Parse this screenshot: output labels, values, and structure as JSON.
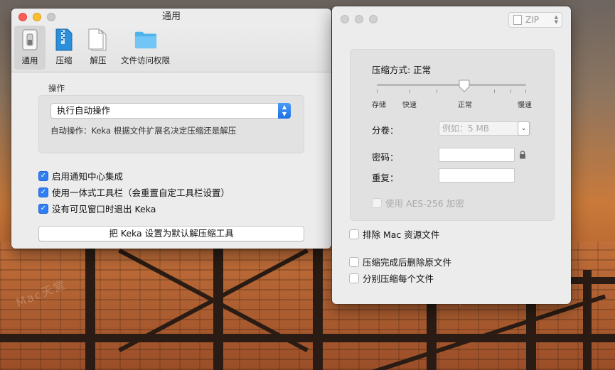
{
  "left_window": {
    "title": "通用",
    "toolbar": [
      {
        "label": "通用",
        "icon": "general-switch-icon",
        "active": true
      },
      {
        "label": "压缩",
        "icon": "zip-file-icon",
        "active": false
      },
      {
        "label": "解压",
        "icon": "extract-document-icon",
        "active": false
      },
      {
        "label": "文件访问权限",
        "icon": "folder-icon",
        "active": false
      }
    ],
    "operation": {
      "section_label": "操作",
      "selected": "执行自动操作",
      "help": "自动操作：Keka 根据文件扩展名决定压缩还是解压"
    },
    "checks": [
      {
        "label": "启用通知中心集成",
        "checked": true
      },
      {
        "label": "使用一体式工具栏（会重置自定工具栏设置）",
        "checked": true
      },
      {
        "label": "没有可见窗口时退出 Keka",
        "checked": true
      }
    ],
    "default_button": "把 Keka 设置为默认解压缩工具"
  },
  "right_window": {
    "format": "ZIP",
    "level_title": "压缩方式: 正常",
    "level_ticks": [
      "存储",
      "快速",
      "正常",
      "慢速"
    ],
    "level_value": "正常",
    "split_label": "分卷：",
    "split_placeholder": "例如：5 MB",
    "password_label": "密码：",
    "repeat_label": "重复：",
    "aes_label": "使用 AES-256 加密",
    "checks": [
      {
        "label": "排除 Mac 资源文件",
        "checked": false
      },
      {
        "label": "压缩完成后删除原文件",
        "checked": false
      },
      {
        "label": "分别压缩每个文件",
        "checked": false
      }
    ]
  },
  "colors": {
    "accent": "#2f7ef6",
    "close": "#fc5f57",
    "minimize": "#fdbc2e"
  }
}
